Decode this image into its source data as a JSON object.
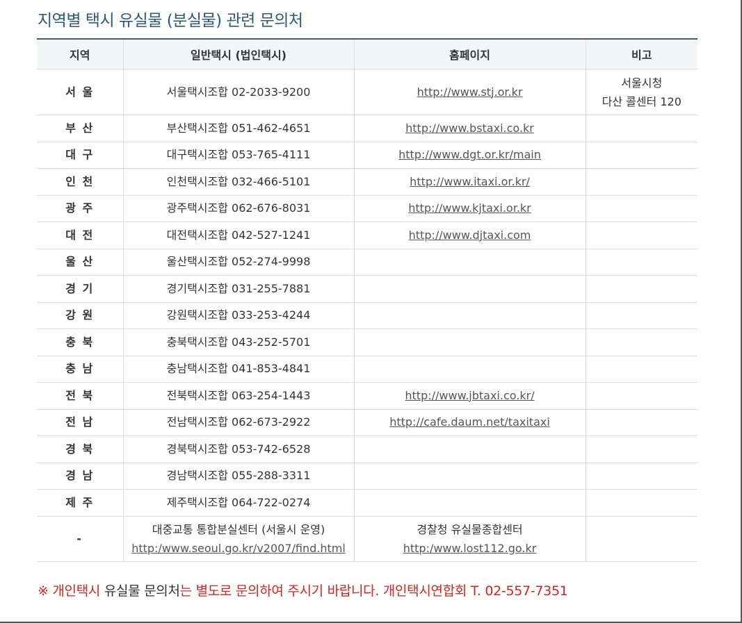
{
  "title": "지역별 택시 유실물 (분실물) 관련 문의처",
  "table": {
    "headers": [
      "지역",
      "일반택시 (법인택시)",
      "홈페이지",
      "비고"
    ],
    "rows": [
      {
        "region": "서 울",
        "contact": "서울택시조합 02-2033-9200",
        "homepage": "http://www.stj.or.kr",
        "note_line1": "서울시청",
        "note_line2": "다산 콜센터 120"
      },
      {
        "region": "부 산",
        "contact": "부산택시조합 051-462-4651",
        "homepage": "http://www.bstaxi.co.kr"
      },
      {
        "region": "대 구",
        "contact": "대구택시조합 053-765-4111",
        "homepage": "http://www.dgt.or.kr/main"
      },
      {
        "region": "인 천",
        "contact": "인천택시조합 032-466-5101",
        "homepage": "http://www.itaxi.or.kr/"
      },
      {
        "region": "광 주",
        "contact": "광주택시조합 062-676-8031",
        "homepage": "http://www.kjtaxi.or.kr"
      },
      {
        "region": "대 전",
        "contact": "대전택시조합 042-527-1241",
        "homepage": "http://www.djtaxi.com"
      },
      {
        "region": "울 산",
        "contact": "울산택시조합 052-274-9998"
      },
      {
        "region": "경 기",
        "contact": "경기택시조합 031-255-7881"
      },
      {
        "region": "강 원",
        "contact": "강원택시조합 033-253-4244"
      },
      {
        "region": "충 북",
        "contact": "충북택시조합 043-252-5701"
      },
      {
        "region": "충 남",
        "contact": "충남택시조합 041-853-4841"
      },
      {
        "region": "전 북",
        "contact": "전북택시조합 063-254-1443",
        "homepage": "http://www.jbtaxi.co.kr/"
      },
      {
        "region": "전 남",
        "contact": "전남택시조합 062-673-2922",
        "homepage": "http://cafe.daum.net/taxitaxi"
      },
      {
        "region": "경 북",
        "contact": "경북택시조합 053-742-6528"
      },
      {
        "region": "경 남",
        "contact": "경남택시조합 055-288-3311"
      },
      {
        "region": "제 주",
        "contact": "제주택시조합 064-722-0274"
      },
      {
        "region": "-",
        "contact_line1": "대중교통 통합분실센터 (서울시 운영)",
        "contact_link": "http:/www.seoul.go.kr/v2007/find.html",
        "homepage_line1": "경찰청 유실물종합센터",
        "homepage_link": "http:/www.lost112.go.kr"
      }
    ]
  },
  "notice": {
    "prefix": "※ 개인택시 ",
    "highlight": "유실물 문의처",
    "suffix": "는 별도로 문의하여 주시기 바랍니다. 개인택시연합회 T. 02-557-7351"
  }
}
